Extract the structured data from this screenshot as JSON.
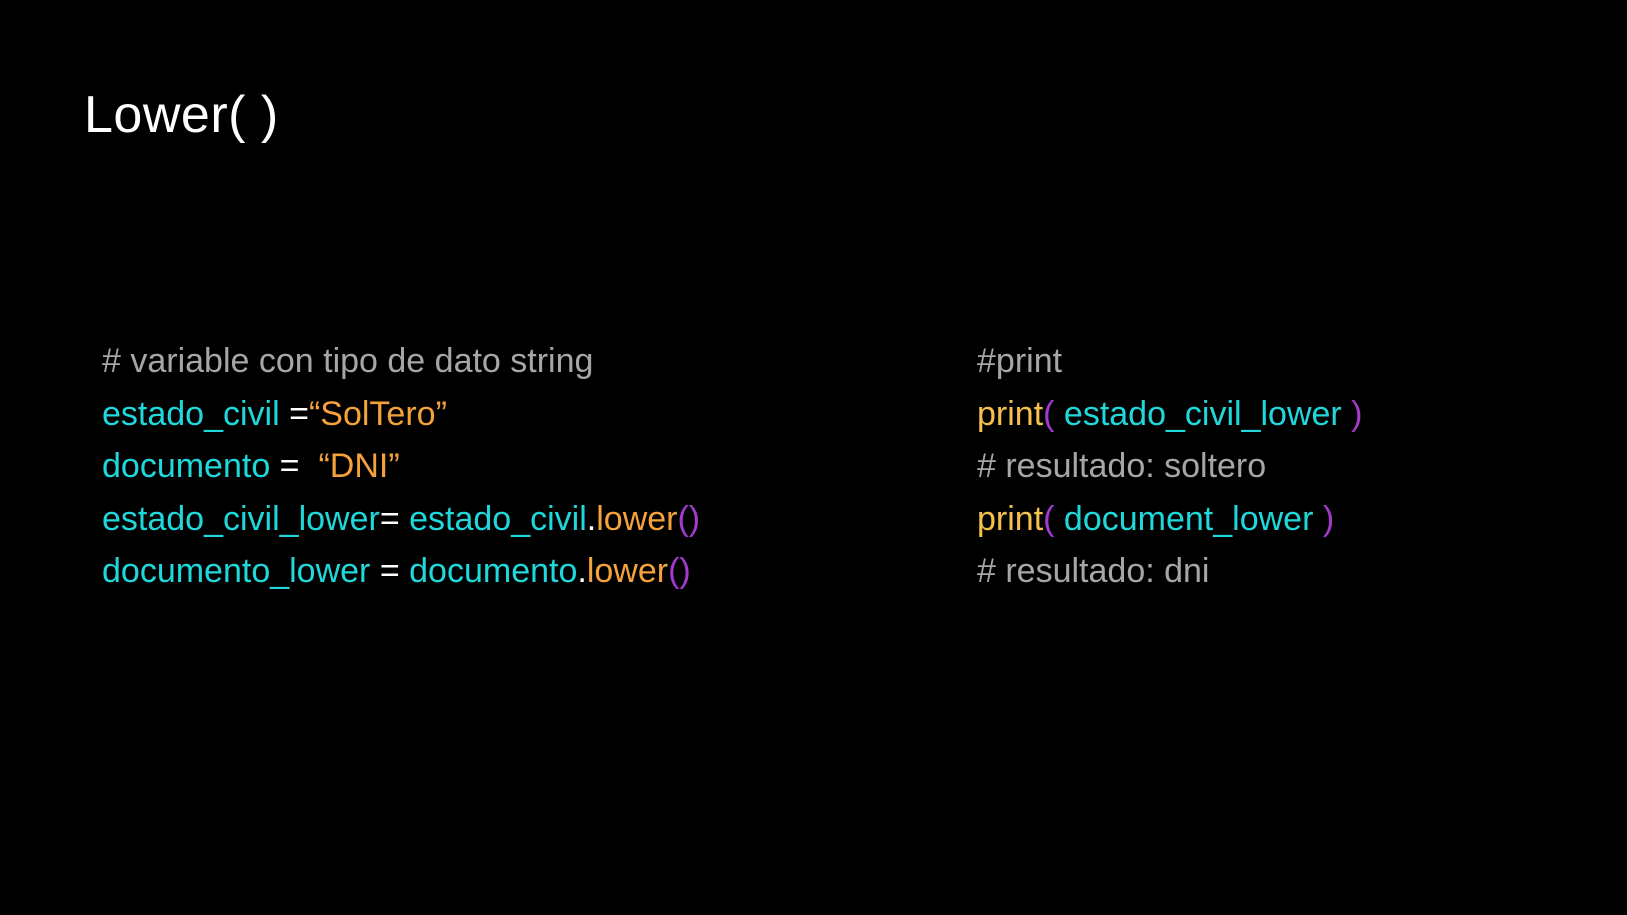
{
  "title": "Lower( )",
  "colors": {
    "background": "#000000",
    "comment": "#a6a6a6",
    "variable": "#1fd8dc",
    "operator": "#ffffff",
    "string": "#f6a23a",
    "method": "#f6a23a",
    "paren": "#a23ad0",
    "function": "#f4c14a"
  },
  "left_code": {
    "comment": "# variable con tipo de dato string",
    "line1": {
      "var": "estado_civil",
      "op": " =",
      "value": "“SolTero”"
    },
    "line2": {
      "var": "documento",
      "op": " =  ",
      "value": "“DNI”"
    },
    "line3": {
      "var": "estado_civil_lower",
      "op": "= ",
      "obj": "estado_civil",
      "dot": ".",
      "method": "lower",
      "parens": "()"
    },
    "line4": {
      "var": "documento_lower",
      "op": " = ",
      "obj": "documento",
      "dot": ".",
      "method": "lower",
      "parens": "()"
    }
  },
  "right_code": {
    "comment": "#print",
    "print1": {
      "func": "print",
      "open": "( ",
      "arg": "estado_civil_lower",
      "close": " )"
    },
    "result1": "# resultado: soltero",
    "print2": {
      "func": "print",
      "open": "( ",
      "arg": "document_lower",
      "close": " )"
    },
    "result2": "# resultado: dni"
  }
}
